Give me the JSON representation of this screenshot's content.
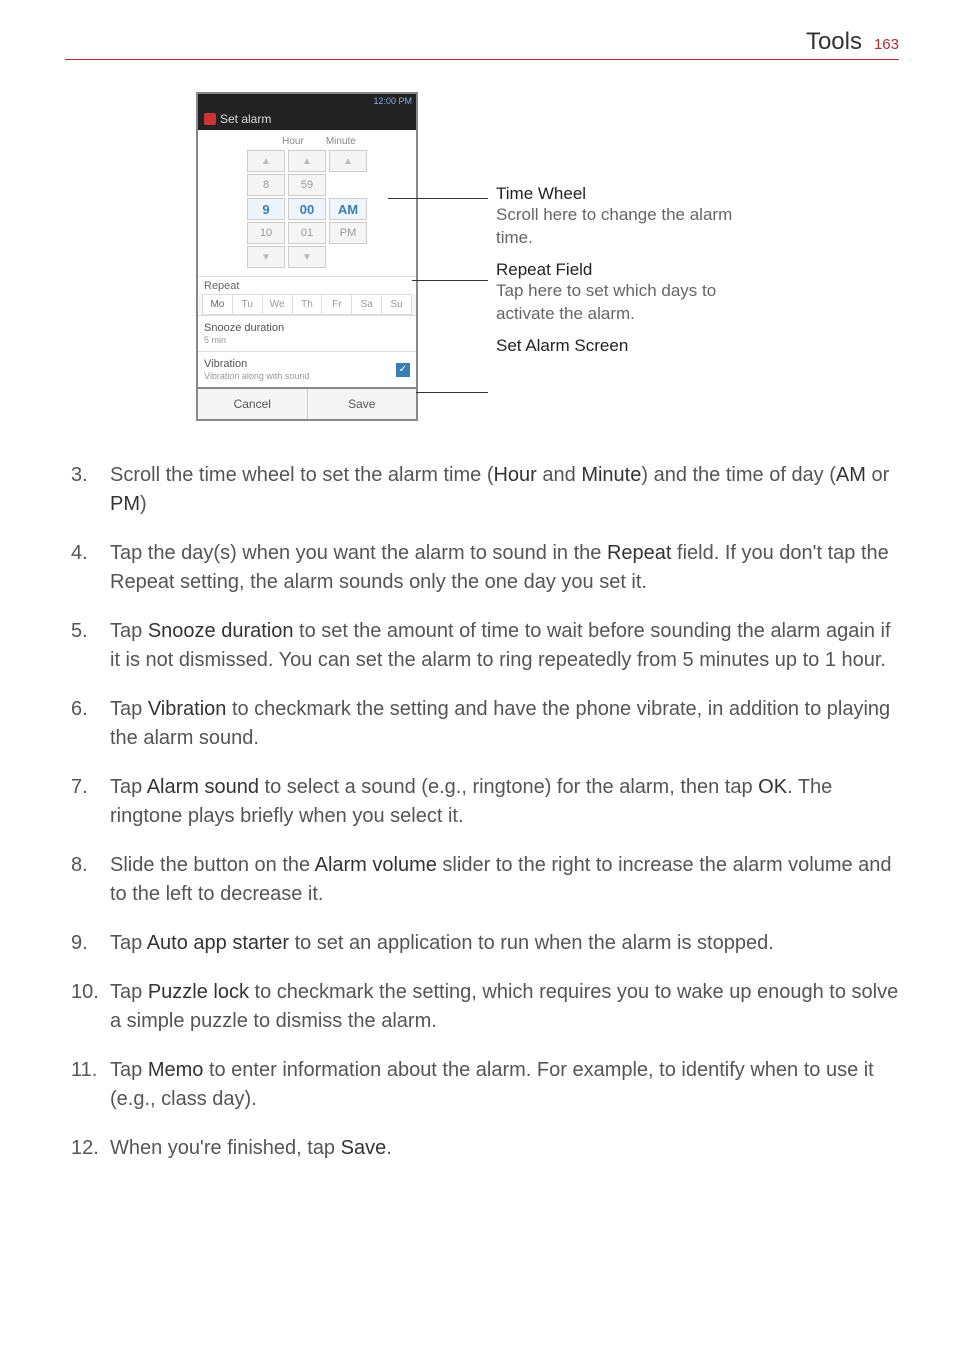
{
  "header": {
    "title": "Tools",
    "page": "163"
  },
  "screen": {
    "status_time": "12:00 PM",
    "app_title": "Set alarm",
    "hour_label": "Hour",
    "minute_label": "Minute",
    "tp_prev_hour": "8",
    "tp_prev_min": "59",
    "hour": "9",
    "minute": "00",
    "ampm": "AM",
    "tp_next_hour": "10",
    "tp_next_min": "01",
    "tp_next_ampm": "PM",
    "repeat_label": "Repeat",
    "days": [
      "Mo",
      "Tu",
      "We",
      "Th",
      "Fr",
      "Sa",
      "Su"
    ],
    "snooze_title": "Snooze duration",
    "snooze_sub": "5 min",
    "vibration_title": "Vibration",
    "vibration_sub": "Vibration along with sound",
    "cancel": "Cancel",
    "save": "Save"
  },
  "annot": {
    "timewheel_title": "Time Wheel",
    "timewheel_desc": "Scroll here to change the alarm time.",
    "repeat_title": "Repeat Field",
    "repeat_desc": "Tap here to set which days to activate the alarm.",
    "setalarm_title": "Set Alarm Screen"
  },
  "steps": {
    "s3a": "Scroll the time wheel to set the alarm time (",
    "s3_hour": "Hour",
    "s3_and": " and ",
    "s3_minute": "Minute",
    "s3b": ") and the time of day (",
    "s3_am": "AM",
    "s3_or": " or ",
    "s3_pm": "PM",
    "s3c": ")",
    "s4a": "Tap the day(s) when you want the alarm to sound in the ",
    "s4_repeat": "Repeat",
    "s4b": " field. If you don't tap the Repeat setting, the alarm sounds only the one day you set it.",
    "s5a": "Tap ",
    "s5_snooze": "Snooze duration",
    "s5b": " to set the amount of time to wait before sounding the alarm again if it is not dismissed. You can set the alarm to ring repeatedly from 5 minutes up to 1 hour.",
    "s6a": "Tap ",
    "s6_vib": "Vibration",
    "s6b": " to checkmark the setting and have the phone vibrate, in addition to playing the alarm sound.",
    "s7a": "Tap ",
    "s7_sound": "Alarm sound",
    "s7b": " to select a sound (e.g., ringtone) for the alarm, then tap ",
    "s7_ok": "OK",
    "s7c": ". The ringtone plays briefly when you select it.",
    "s8a": "Slide the button on the ",
    "s8_vol": "Alarm volume",
    "s8b": " slider to the right to increase the alarm volume and to the left to decrease it.",
    "s9a": "Tap ",
    "s9_auto": "Auto app starter",
    "s9b": " to set an application to run when the alarm is stopped.",
    "s10a": "Tap ",
    "s10_puzzle": "Puzzle lock",
    "s10b": " to checkmark the setting, which requires you to wake up enough to solve a simple puzzle to dismiss the alarm.",
    "s11a": "Tap ",
    "s11_memo": "Memo",
    "s11b": " to enter information about the alarm. For example, to identify when to use it (e.g., class day).",
    "s12a": "When you're finished, tap ",
    "s12_save": "Save",
    "s12b": "."
  }
}
